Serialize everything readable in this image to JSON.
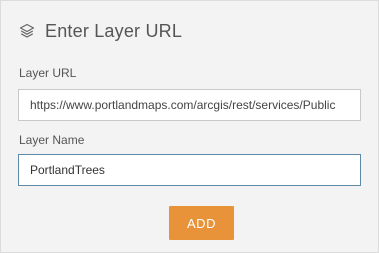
{
  "header": {
    "title": "Enter Layer URL",
    "icon": "layers-icon"
  },
  "form": {
    "url_label": "Layer URL",
    "url_value": "https://www.portlandmaps.com/arcgis/rest/services/Public",
    "name_label": "Layer Name",
    "name_value": "PortlandTrees"
  },
  "actions": {
    "add_label": "ADD"
  },
  "colors": {
    "accent": "#e8923a",
    "panel_background": "#f3f3f3",
    "focused_border": "#5d8aa8"
  }
}
